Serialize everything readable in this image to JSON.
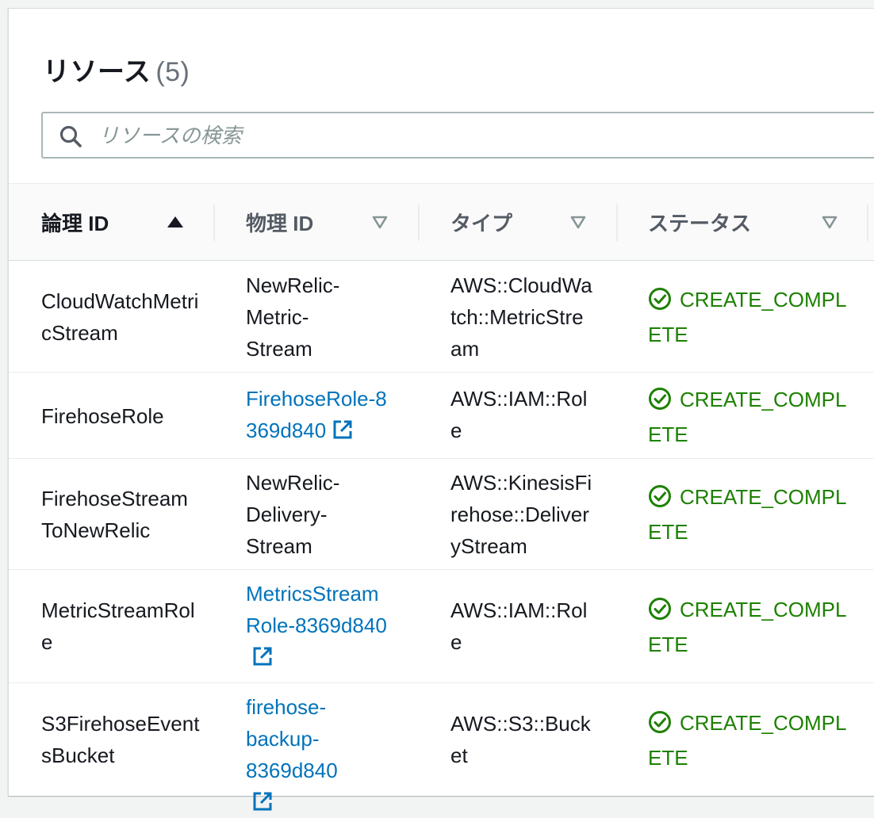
{
  "panel": {
    "title": "リソース",
    "count": "(5)"
  },
  "search": {
    "placeholder": "リソースの検索",
    "value": ""
  },
  "table": {
    "columns": [
      {
        "label": "論理 ID",
        "sort": "ascending"
      },
      {
        "label": "物理 ID",
        "sort": "none"
      },
      {
        "label": "タイプ",
        "sort": "none"
      },
      {
        "label": "ステータス",
        "sort": "none"
      }
    ],
    "rows": [
      {
        "logical_id": "CloudWatchMetricStream",
        "physical_id": "NewRelic-Metric-Stream",
        "physical_is_link": false,
        "type": "AWS::CloudWatch::MetricStream",
        "status": "CREATE_COMPLETE"
      },
      {
        "logical_id": "FirehoseRole",
        "physical_id": "FirehoseRole-8369d840",
        "physical_is_link": true,
        "type": "AWS::IAM::Role",
        "status": "CREATE_COMPLETE"
      },
      {
        "logical_id": "FirehoseStreamToNewRelic",
        "physical_id": "NewRelic-Delivery-Stream",
        "physical_is_link": false,
        "type": "AWS::KinesisFirehose::DeliveryStream",
        "status": "CREATE_COMPLETE"
      },
      {
        "logical_id": "MetricStreamRole",
        "physical_id": "MetricsStreamRole-8369d840",
        "physical_is_link": true,
        "type": "AWS::IAM::Role",
        "status": "CREATE_COMPLETE"
      },
      {
        "logical_id": "S3FirehoseEventsBucket",
        "physical_id": "firehose-backup-8369d840",
        "physical_is_link": true,
        "type": "AWS::S3::Bucket",
        "status": "CREATE_COMPLETE"
      }
    ]
  },
  "icons": {
    "search": "search-icon",
    "sort_active": "sort-ascending-icon",
    "sort_inactive": "sort-caret-down-icon",
    "external_link": "external-link-icon",
    "status_ok": "check-circle-icon"
  },
  "colors": {
    "link": "#0073bb",
    "success": "#1d8102",
    "header_text": "#545b64"
  }
}
